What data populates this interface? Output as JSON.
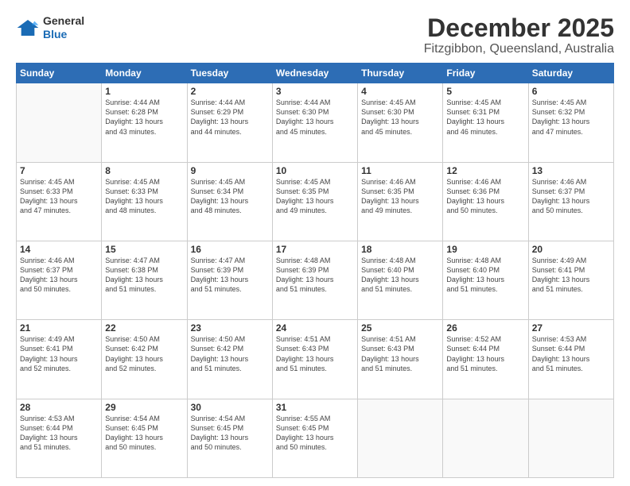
{
  "logo": {
    "line1": "General",
    "line2": "Blue"
  },
  "header": {
    "title": "December 2025",
    "subtitle": "Fitzgibbon, Queensland, Australia"
  },
  "weekdays": [
    "Sunday",
    "Monday",
    "Tuesday",
    "Wednesday",
    "Thursday",
    "Friday",
    "Saturday"
  ],
  "weeks": [
    [
      {
        "day": "",
        "info": ""
      },
      {
        "day": "1",
        "info": "Sunrise: 4:44 AM\nSunset: 6:28 PM\nDaylight: 13 hours\nand 43 minutes."
      },
      {
        "day": "2",
        "info": "Sunrise: 4:44 AM\nSunset: 6:29 PM\nDaylight: 13 hours\nand 44 minutes."
      },
      {
        "day": "3",
        "info": "Sunrise: 4:44 AM\nSunset: 6:30 PM\nDaylight: 13 hours\nand 45 minutes."
      },
      {
        "day": "4",
        "info": "Sunrise: 4:45 AM\nSunset: 6:30 PM\nDaylight: 13 hours\nand 45 minutes."
      },
      {
        "day": "5",
        "info": "Sunrise: 4:45 AM\nSunset: 6:31 PM\nDaylight: 13 hours\nand 46 minutes."
      },
      {
        "day": "6",
        "info": "Sunrise: 4:45 AM\nSunset: 6:32 PM\nDaylight: 13 hours\nand 47 minutes."
      }
    ],
    [
      {
        "day": "7",
        "info": "Sunrise: 4:45 AM\nSunset: 6:33 PM\nDaylight: 13 hours\nand 47 minutes."
      },
      {
        "day": "8",
        "info": "Sunrise: 4:45 AM\nSunset: 6:33 PM\nDaylight: 13 hours\nand 48 minutes."
      },
      {
        "day": "9",
        "info": "Sunrise: 4:45 AM\nSunset: 6:34 PM\nDaylight: 13 hours\nand 48 minutes."
      },
      {
        "day": "10",
        "info": "Sunrise: 4:45 AM\nSunset: 6:35 PM\nDaylight: 13 hours\nand 49 minutes."
      },
      {
        "day": "11",
        "info": "Sunrise: 4:46 AM\nSunset: 6:35 PM\nDaylight: 13 hours\nand 49 minutes."
      },
      {
        "day": "12",
        "info": "Sunrise: 4:46 AM\nSunset: 6:36 PM\nDaylight: 13 hours\nand 50 minutes."
      },
      {
        "day": "13",
        "info": "Sunrise: 4:46 AM\nSunset: 6:37 PM\nDaylight: 13 hours\nand 50 minutes."
      }
    ],
    [
      {
        "day": "14",
        "info": "Sunrise: 4:46 AM\nSunset: 6:37 PM\nDaylight: 13 hours\nand 50 minutes."
      },
      {
        "day": "15",
        "info": "Sunrise: 4:47 AM\nSunset: 6:38 PM\nDaylight: 13 hours\nand 51 minutes."
      },
      {
        "day": "16",
        "info": "Sunrise: 4:47 AM\nSunset: 6:39 PM\nDaylight: 13 hours\nand 51 minutes."
      },
      {
        "day": "17",
        "info": "Sunrise: 4:48 AM\nSunset: 6:39 PM\nDaylight: 13 hours\nand 51 minutes."
      },
      {
        "day": "18",
        "info": "Sunrise: 4:48 AM\nSunset: 6:40 PM\nDaylight: 13 hours\nand 51 minutes."
      },
      {
        "day": "19",
        "info": "Sunrise: 4:48 AM\nSunset: 6:40 PM\nDaylight: 13 hours\nand 51 minutes."
      },
      {
        "day": "20",
        "info": "Sunrise: 4:49 AM\nSunset: 6:41 PM\nDaylight: 13 hours\nand 51 minutes."
      }
    ],
    [
      {
        "day": "21",
        "info": "Sunrise: 4:49 AM\nSunset: 6:41 PM\nDaylight: 13 hours\nand 52 minutes."
      },
      {
        "day": "22",
        "info": "Sunrise: 4:50 AM\nSunset: 6:42 PM\nDaylight: 13 hours\nand 52 minutes."
      },
      {
        "day": "23",
        "info": "Sunrise: 4:50 AM\nSunset: 6:42 PM\nDaylight: 13 hours\nand 51 minutes."
      },
      {
        "day": "24",
        "info": "Sunrise: 4:51 AM\nSunset: 6:43 PM\nDaylight: 13 hours\nand 51 minutes."
      },
      {
        "day": "25",
        "info": "Sunrise: 4:51 AM\nSunset: 6:43 PM\nDaylight: 13 hours\nand 51 minutes."
      },
      {
        "day": "26",
        "info": "Sunrise: 4:52 AM\nSunset: 6:44 PM\nDaylight: 13 hours\nand 51 minutes."
      },
      {
        "day": "27",
        "info": "Sunrise: 4:53 AM\nSunset: 6:44 PM\nDaylight: 13 hours\nand 51 minutes."
      }
    ],
    [
      {
        "day": "28",
        "info": "Sunrise: 4:53 AM\nSunset: 6:44 PM\nDaylight: 13 hours\nand 51 minutes."
      },
      {
        "day": "29",
        "info": "Sunrise: 4:54 AM\nSunset: 6:45 PM\nDaylight: 13 hours\nand 50 minutes."
      },
      {
        "day": "30",
        "info": "Sunrise: 4:54 AM\nSunset: 6:45 PM\nDaylight: 13 hours\nand 50 minutes."
      },
      {
        "day": "31",
        "info": "Sunrise: 4:55 AM\nSunset: 6:45 PM\nDaylight: 13 hours\nand 50 minutes."
      },
      {
        "day": "",
        "info": ""
      },
      {
        "day": "",
        "info": ""
      },
      {
        "day": "",
        "info": ""
      }
    ]
  ]
}
